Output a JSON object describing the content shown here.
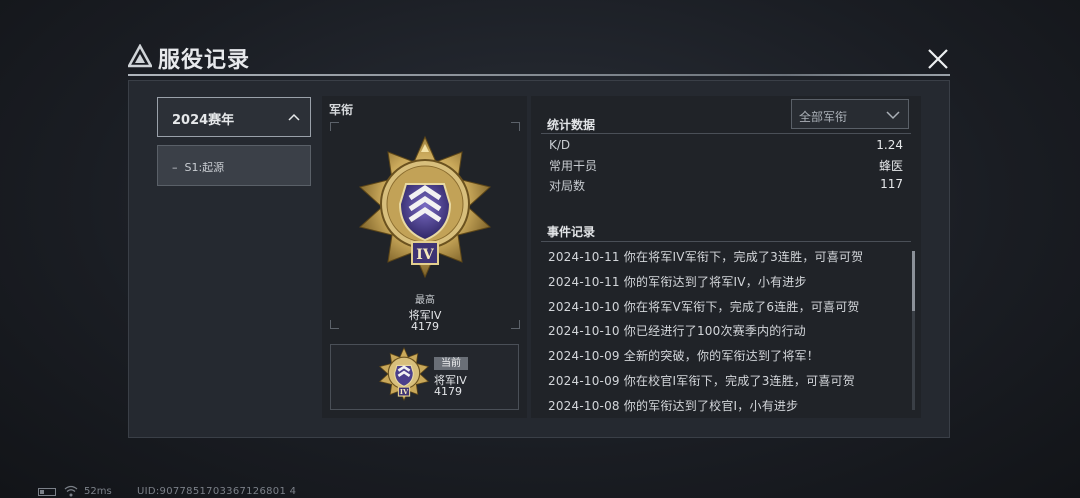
{
  "header": {
    "title": "服役记录"
  },
  "sidebar": {
    "season_selected": "2024赛年",
    "seasons": [
      {
        "label": "S1:起源"
      }
    ]
  },
  "rank": {
    "title": "军衔",
    "best_label": "最高",
    "best_name": "将军IV",
    "best_score": "4179",
    "medal_numeral": "IV",
    "current_badge": "当前",
    "current_name": "将军IV",
    "current_score": "4179"
  },
  "stats": {
    "filter_value": "全部军衔",
    "title": "统计数据",
    "rows": [
      {
        "key": "K/D",
        "value": "1.24"
      },
      {
        "key": "常用干员",
        "value": "蜂医"
      },
      {
        "key": "对局数",
        "value": "117"
      }
    ]
  },
  "events": {
    "title": "事件记录",
    "items": [
      "2024-10-11 你在将军IV军衔下，完成了3连胜，可喜可贺",
      "2024-10-11 你的军衔达到了将军IV，小有进步",
      "2024-10-10 你在将军V军衔下，完成了6连胜，可喜可贺",
      "2024-10-10 你已经进行了100次赛季内的行动",
      "2024-10-09 全新的突破，你的军衔达到了将军！",
      "2024-10-09 你在校官Ⅰ军衔下，完成了3连胜，可喜可贺",
      "2024-10-08 你的军衔达到了校官Ⅰ，小有进步"
    ]
  },
  "status_bar": {
    "ping": "52ms",
    "uid": "UID:9077851703367126801 4"
  },
  "colors": {
    "medal_gold": "#c9a85a",
    "medal_purple": "#4b3f8c"
  }
}
